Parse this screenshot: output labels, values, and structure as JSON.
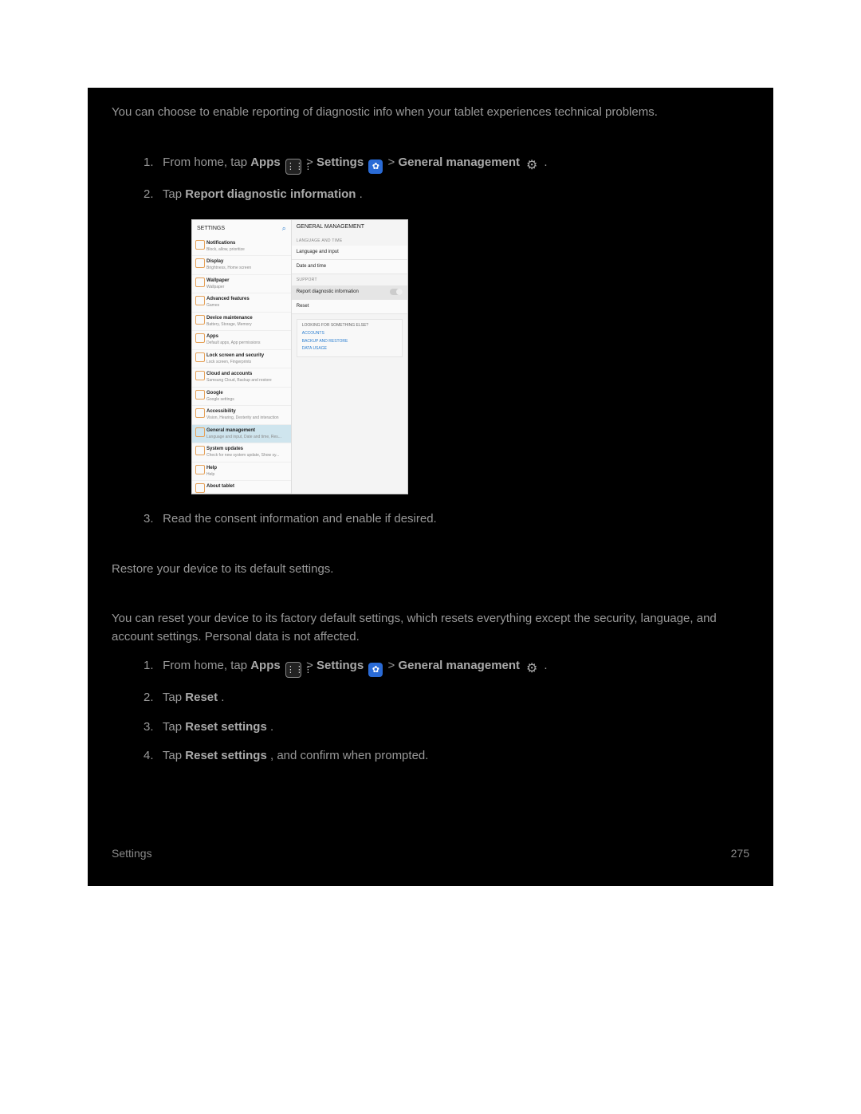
{
  "intro": "You can choose to enable reporting of diagnostic info when your tablet experiences technical problems.",
  "section1": {
    "steps": {
      "s1": {
        "num": "1.",
        "pre": "From home, tap ",
        "apps": "Apps",
        "gt1": " > ",
        "settings": "Settings",
        "gt2": " > ",
        "gm": "General management",
        "end": "."
      },
      "s2": {
        "num": "2.",
        "pre": "Tap ",
        "bold": "Report diagnostic information",
        "end": "."
      },
      "s3": {
        "num": "3.",
        "text": "Read the consent information and enable if desired."
      }
    }
  },
  "section2": {
    "desc": "Restore your device to its default settings.",
    "desc2": "You can reset your device to its factory default settings, which resets everything except the security, language, and account settings. Personal data is not affected.",
    "steps": {
      "s1": {
        "num": "1.",
        "pre": "From home, tap ",
        "apps": "Apps",
        "gt1": " > ",
        "settings": "Settings",
        "gt2": " > ",
        "gm": "General management",
        "end": "."
      },
      "s2": {
        "num": "2.",
        "pre": "Tap ",
        "bold": "Reset",
        "end": "."
      },
      "s3": {
        "num": "3.",
        "pre": "Tap ",
        "bold": "Reset settings",
        "end": "."
      },
      "s4": {
        "num": "4.",
        "pre": "Tap ",
        "bold": "Reset settings",
        "end": ", and confirm when prompted."
      }
    }
  },
  "screenshot": {
    "left_header": "SETTINGS",
    "right_header": "GENERAL MANAGEMENT",
    "left_items": [
      {
        "t": "Notifications",
        "s": "Block, allow, prioritize"
      },
      {
        "t": "Display",
        "s": "Brightness, Home screen"
      },
      {
        "t": "Wallpaper",
        "s": "Wallpaper"
      },
      {
        "t": "Advanced features",
        "s": "Games"
      },
      {
        "t": "Device maintenance",
        "s": "Battery, Storage, Memory"
      },
      {
        "t": "Apps",
        "s": "Default apps, App permissions"
      },
      {
        "t": "Lock screen and security",
        "s": "Lock screen, Fingerprints"
      },
      {
        "t": "Cloud and accounts",
        "s": "Samsung Cloud, Backup and restore"
      },
      {
        "t": "Google",
        "s": "Google settings"
      },
      {
        "t": "Accessibility",
        "s": "Vision, Hearing, Dexterity and interaction"
      },
      {
        "t": "General management",
        "s": "Language and input, Date and time, Res...",
        "sel": true
      },
      {
        "t": "System updates",
        "s": "Check for new system update, Show sy..."
      },
      {
        "t": "Help",
        "s": "Help"
      },
      {
        "t": "About tablet",
        "s": ""
      }
    ],
    "right": {
      "sec1": "LANGUAGE AND TIME",
      "i1": "Language and input",
      "i2": "Date and time",
      "sec2": "SUPPORT",
      "i3": "Report diagnostic information",
      "i4": "Reset",
      "box_h": "LOOKING FOR SOMETHING ELSE?",
      "l1": "ACCOUNTS",
      "l2": "BACKUP AND RESTORE",
      "l3": "DATA USAGE"
    }
  },
  "footer": {
    "left": "Settings",
    "right": "275"
  }
}
